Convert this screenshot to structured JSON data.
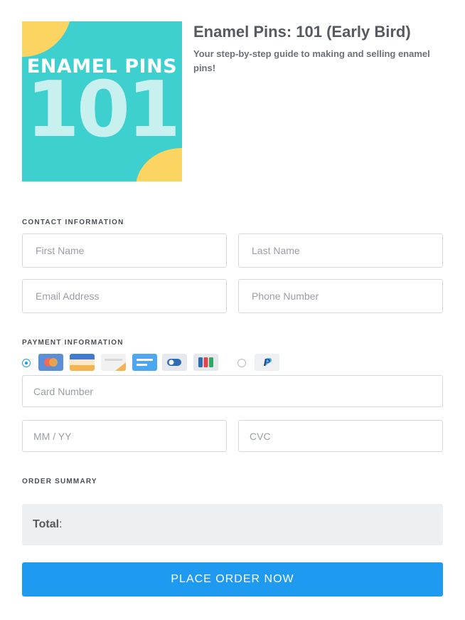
{
  "product": {
    "image_title": "ENAMEL PINS",
    "image_number": "101",
    "title": "Enamel Pins: 101 (Early Bird)",
    "subtitle": "Your step-by-step guide to making and selling enamel pins!"
  },
  "contact": {
    "label": "CONTACT INFORMATION",
    "first_name_placeholder": "First Name",
    "last_name_placeholder": "Last Name",
    "email_placeholder": "Email Address",
    "phone_placeholder": "Phone Number"
  },
  "payment": {
    "label": "PAYMENT INFORMATION",
    "selected_method": "card",
    "card_icons": [
      "mastercard-icon",
      "amex-icon",
      "discover-icon",
      "generic-card-icon",
      "diners-icon",
      "jcb-icon"
    ],
    "paypal_icon": "paypal-icon",
    "card_number_placeholder": "Card Number",
    "expiry_placeholder": "MM / YY",
    "cvc_placeholder": "CVC"
  },
  "summary": {
    "label": "ORDER SUMMARY",
    "total_label": "Total",
    "total_colon": ":"
  },
  "actions": {
    "place_order_label": "PLACE ORDER NOW"
  },
  "colors": {
    "accent": "#1e9bf0",
    "image_bg": "#3ecfcf",
    "image_accent": "#fcd462"
  }
}
